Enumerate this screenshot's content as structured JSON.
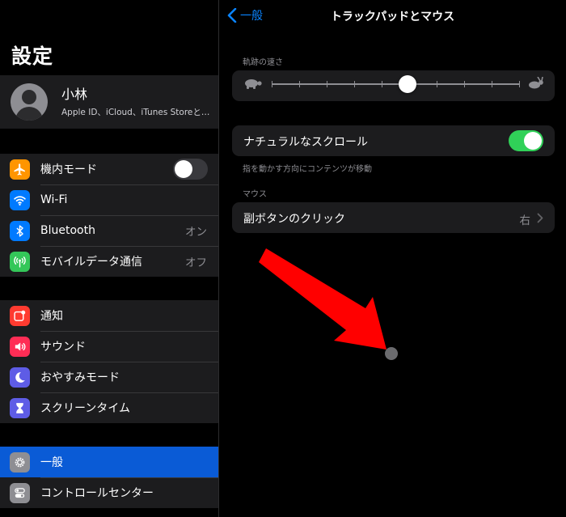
{
  "sidebar": {
    "title": "設定",
    "profile": {
      "name": "小林",
      "subtitle": "Apple ID、iCloud、iTunes Storeと…"
    },
    "groups": [
      {
        "items": [
          {
            "label": "機内モード",
            "icon": "airplane-icon",
            "color": "#ff9500",
            "control": "toggle",
            "on": false
          },
          {
            "label": "Wi-Fi",
            "icon": "wifi-icon",
            "color": "#007aff"
          },
          {
            "label": "Bluetooth",
            "icon": "bluetooth-icon",
            "color": "#007aff",
            "value": "オン"
          },
          {
            "label": "モバイルデータ通信",
            "icon": "antenna-icon",
            "color": "#34c759",
            "value": "オフ"
          }
        ]
      },
      {
        "items": [
          {
            "label": "通知",
            "icon": "notification-icon",
            "color": "#ff3b30"
          },
          {
            "label": "サウンド",
            "icon": "speaker-icon",
            "color": "#ff2d55"
          },
          {
            "label": "おやすみモード",
            "icon": "moon-icon",
            "color": "#5e5ce6"
          },
          {
            "label": "スクリーンタイム",
            "icon": "hourglass-icon",
            "color": "#5e5ce6"
          }
        ]
      },
      {
        "items": [
          {
            "label": "一般",
            "icon": "gear-icon",
            "color": "#8e8e93",
            "selected": true
          },
          {
            "label": "コントロールセンター",
            "icon": "switches-icon",
            "color": "#8e8e93"
          }
        ]
      }
    ]
  },
  "detail": {
    "back_label": "一般",
    "title": "トラックパッドとマウス",
    "tracking": {
      "section_label": "軌跡の速さ",
      "value_fraction": 0.55,
      "tick_count": 10,
      "slow_icon": "turtle-icon",
      "fast_icon": "rabbit-icon"
    },
    "natural_scroll": {
      "label": "ナチュラルなスクロール",
      "on": true,
      "footnote": "指を動かす方向にコンテンツが移動"
    },
    "mouse": {
      "section_label": "マウス",
      "secondary_click_label": "副ボタンのクリック",
      "secondary_click_value": "右"
    }
  },
  "colors": {
    "accent": "#0a84ff",
    "toggle_on": "#30d158",
    "selected_row": "#0a5bd6",
    "arrow": "#ff0000"
  }
}
